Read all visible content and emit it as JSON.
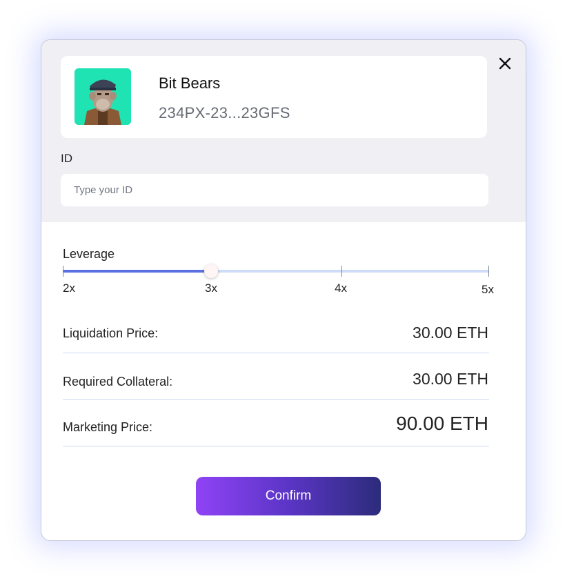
{
  "nft": {
    "name": "Bit Bears",
    "address": "234PX-23...23GFS",
    "image": "ape-avatar-icon"
  },
  "id_field": {
    "label": "ID",
    "placeholder": "Type your ID",
    "value": ""
  },
  "leverage": {
    "label": "Leverage",
    "steps": [
      "2x",
      "3x",
      "4x",
      "5x"
    ],
    "selected": "3x"
  },
  "details": [
    {
      "label": "Liquidation Price:",
      "value": "30.00 ETH"
    },
    {
      "label": "Required Collateral:",
      "value": "30.00 ETH"
    },
    {
      "label": "Marketing Price:",
      "value": "90.00 ETH"
    }
  ],
  "confirm_label": "Confirm",
  "colors": {
    "accent": "#5a6fe0",
    "button_gradient_start": "#8f43f5",
    "button_gradient_end": "#2c2c7b",
    "avatar_bg": "#1fe3b3"
  }
}
